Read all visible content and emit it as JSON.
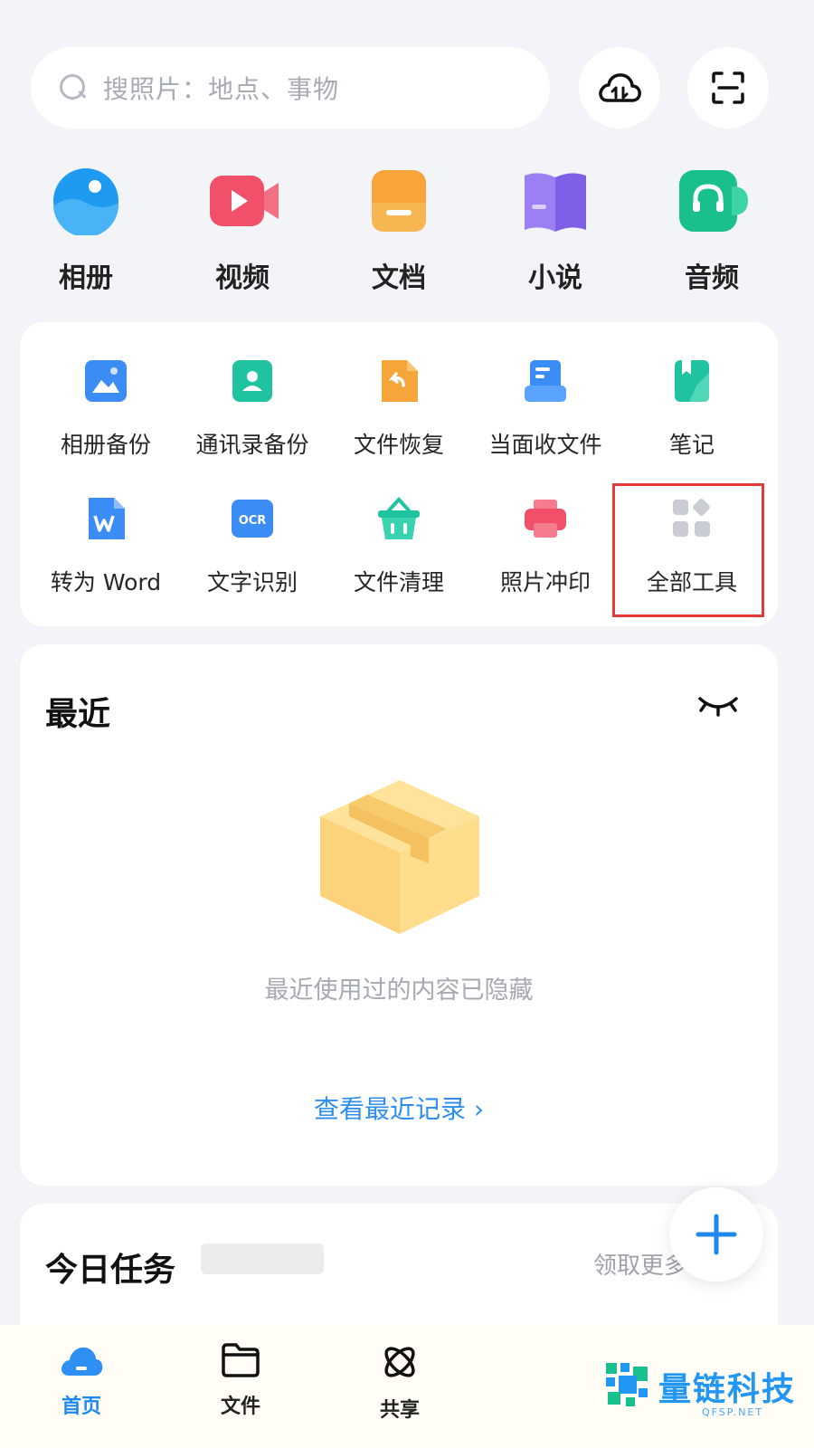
{
  "search": {
    "placeholder": "搜照片：地点、事物"
  },
  "top_actions": [
    {
      "name": "cloud-transfer",
      "icon": "cloud-transfer-icon"
    },
    {
      "name": "scan",
      "icon": "scan-icon"
    }
  ],
  "categories": [
    {
      "label": "相册",
      "icon": "album-icon",
      "color": "#1e9af0"
    },
    {
      "label": "视频",
      "icon": "video-icon",
      "color": "#f0506a"
    },
    {
      "label": "文档",
      "icon": "document-icon",
      "color": "#f7a43a"
    },
    {
      "label": "小说",
      "icon": "book-icon",
      "color": "#8c6ef0"
    },
    {
      "label": "音频",
      "icon": "audio-icon",
      "color": "#19c08e"
    }
  ],
  "tools": [
    {
      "label": "相册备份",
      "icon": "photo-backup-icon",
      "color": "#3b8df5"
    },
    {
      "label": "通讯录备份",
      "icon": "contacts-backup-icon",
      "color": "#20c3a0"
    },
    {
      "label": "文件恢复",
      "icon": "file-restore-icon",
      "color": "#f5a53a"
    },
    {
      "label": "当面收文件",
      "icon": "receive-file-icon",
      "color": "#3b8df5"
    },
    {
      "label": "笔记",
      "icon": "notes-icon",
      "color": "#20c3a0"
    },
    {
      "label": "转为 Word",
      "icon": "word-icon",
      "color": "#3b8df5"
    },
    {
      "label": "文字识别",
      "icon": "ocr-icon",
      "color": "#3b8df5",
      "glyph": "OCR"
    },
    {
      "label": "文件清理",
      "icon": "clean-basket-icon",
      "color": "#20c3a0"
    },
    {
      "label": "照片冲印",
      "icon": "photo-print-icon",
      "color": "#f0506a"
    },
    {
      "label": "全部工具",
      "icon": "all-tools-icon",
      "color": "#c9ccd2"
    }
  ],
  "recent": {
    "title": "最近",
    "empty_text": "最近使用过的内容已隐藏",
    "history_link": "查看最近记录 ›"
  },
  "tasks": {
    "title": "今日任务",
    "more": "领取更多"
  },
  "bottom_nav": [
    {
      "label": "首页",
      "icon": "home-cloud-icon",
      "active": true
    },
    {
      "label": "文件",
      "icon": "folder-icon",
      "active": false
    },
    {
      "label": "共享",
      "icon": "share-icon",
      "active": false
    }
  ],
  "watermark": {
    "text": "量链科技",
    "sub": "QFSP.NET"
  }
}
